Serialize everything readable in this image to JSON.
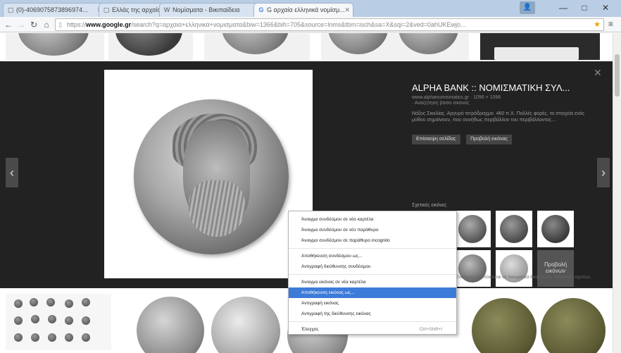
{
  "browser": {
    "tabs": [
      {
        "label": "(0)-4069075873896974...",
        "icon": "page-icon"
      },
      {
        "label": "Ελλάς της αρχαίας...",
        "icon": "page-icon"
      },
      {
        "label": "Νομίσματα - Βικιπαίδεια",
        "icon": "wikipedia-icon"
      },
      {
        "label": "G αρχαία ελληνικά νομίσμ...",
        "icon": "google-icon",
        "active": true
      }
    ],
    "address": {
      "scheme": "https://",
      "host": "www.google.gr",
      "path": "/search?q=αρχαια+ελληνικα+νομισματα&biw=1366&bih=705&source=lnms&tbm=isch&sa=X&sqi=2&ved=0ahUKEwjo..."
    }
  },
  "panel": {
    "title": "ALPHA BANK :: ΝΟΜΙΣΜΑΤΙΚΗ ΣΥΛ...",
    "meta": "www.alphanumismatics.gr · 1096 × 1096",
    "meta2": "· Αναζήτηση βάσει εικόνας",
    "description": "Νάξος Σικελίας. Αργυρό τετράδραχμο. 460 π.Χ. Πολλές φορές, τα στοιχεία ενός μύθου σημαίνουν, που συνήθως περιβάλλον του περιβάλλοντος...",
    "buttons": [
      "Επίσκεψη σελίδας",
      "Προβολή εικόνας"
    ],
    "related_label": "Σχετικές εικόνες",
    "more_label": "Προβολή εικόνων",
    "footer": "Ενδέχεται να υπόκεινται σε πνευματικά δικαιώματα · Αποστολή σχολίων"
  },
  "context_menu": {
    "items": [
      {
        "label": "Άνοιγμα συνδέσμου σε νέα καρτέλα"
      },
      {
        "label": "Άνοιγμα συνδέσμου σε νέο παράθυρο"
      },
      {
        "label": "Άνοιγμα συνδέσμου σε παράθυρο incognito"
      },
      {
        "separator": true
      },
      {
        "label": "Αποθήκευση συνδέσμου ως..."
      },
      {
        "label": "Αντιγραφή διεύθυνσης συνδέσμου"
      },
      {
        "separator": true
      },
      {
        "label": "Άνοιγμα εικόνας σε νέα καρτέλα"
      },
      {
        "label": "Αποθήκευση εικόνας ως...",
        "highlighted": true
      },
      {
        "label": "Αντιγραφή εικόνας"
      },
      {
        "label": "Αντιγραφή της διεύθυνσης εικόνας"
      },
      {
        "separator": true
      },
      {
        "label": "Έλεγχος",
        "shortcut": "Ctrl+Shift+I"
      }
    ]
  }
}
